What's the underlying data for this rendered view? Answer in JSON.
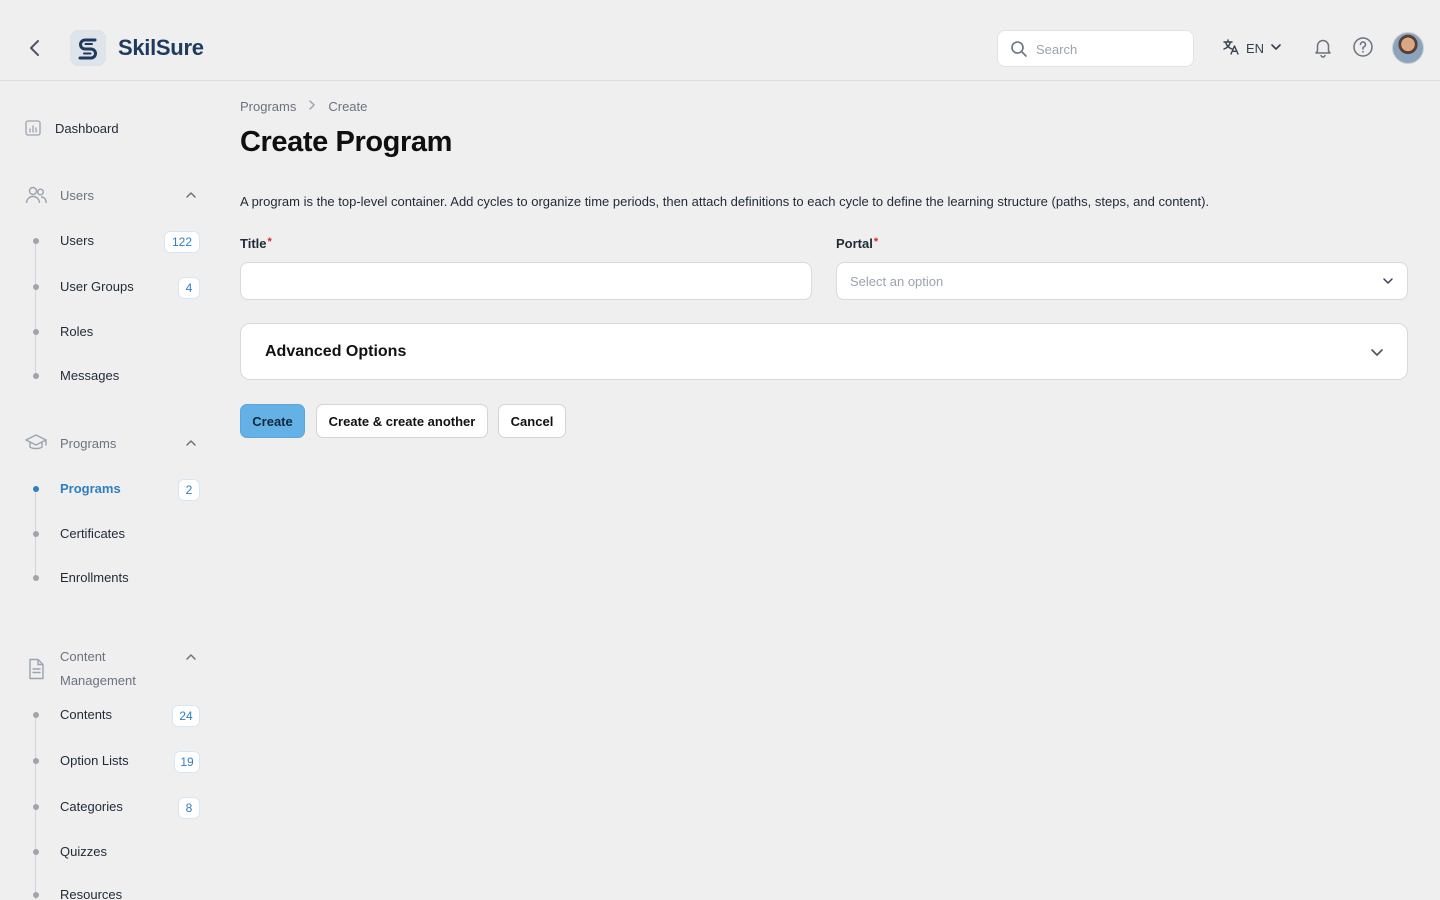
{
  "header": {
    "brand": "SkilSure",
    "search_placeholder": "Search",
    "language": "EN"
  },
  "sidebar": {
    "dashboard": "Dashboard",
    "groups": [
      {
        "label": "Users",
        "items": [
          {
            "label": "Users",
            "badge": "122"
          },
          {
            "label": "User Groups",
            "badge": "4"
          },
          {
            "label": "Roles"
          },
          {
            "label": "Messages"
          }
        ]
      },
      {
        "label": "Programs",
        "items": [
          {
            "label": "Programs",
            "badge": "2",
            "active": true
          },
          {
            "label": "Certificates"
          },
          {
            "label": "Enrollments"
          }
        ]
      },
      {
        "label_line1": "Content",
        "label_line2": "Management",
        "items": [
          {
            "label": "Contents",
            "badge": "24"
          },
          {
            "label": "Option Lists",
            "badge": "19"
          },
          {
            "label": "Categories",
            "badge": "8"
          },
          {
            "label": "Quizzes"
          },
          {
            "label": "Resources"
          }
        ]
      }
    ]
  },
  "main": {
    "breadcrumb": [
      "Programs",
      "Create"
    ],
    "title": "Create Program",
    "description": "A program is the top-level container. Add cycles to organize time periods, then attach definitions to each cycle to define the learning structure (paths, steps, and content).",
    "form": {
      "title_label": "Title",
      "title_value": "",
      "portal_label": "Portal",
      "portal_placeholder": "Select an option",
      "required_mark": "*"
    },
    "advanced_options": "Advanced Options",
    "buttons": {
      "create": "Create",
      "create_another": "Create & create another",
      "cancel": "Cancel"
    }
  },
  "colors": {
    "accent": "#2f7fc1",
    "primary_button": "#64b1e6",
    "background": "#efefef",
    "required": "#dc2626"
  }
}
